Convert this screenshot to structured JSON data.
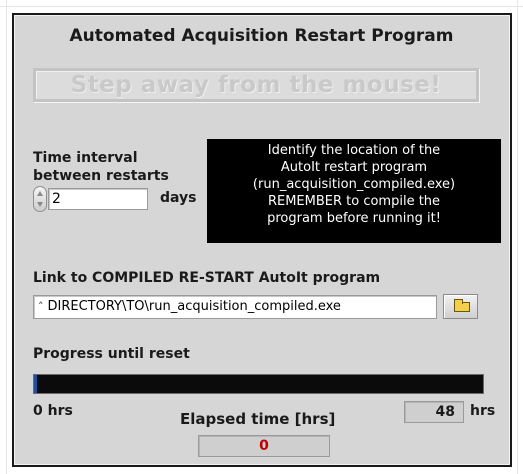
{
  "title": "Automated Acquisition Restart Program",
  "status_message": "Step away from the mouse!",
  "time_interval": {
    "label_line1": "Time interval",
    "label_line2": "between restarts",
    "value": "2",
    "unit": "days"
  },
  "info_box": {
    "line1": "Identify the location of the",
    "line2": "AutoIt restart program",
    "line3": "(run_acquisition_compiled.exe)",
    "line4": "REMEMBER to compile the",
    "line5": "program before running it!"
  },
  "program_link": {
    "label": "Link to COMPILED RE-START AutoIt program",
    "path": "DIRECTORY\\TO\\run_acquisition_compiled.exe",
    "path_icon": "path-glyph-icon",
    "browse_icon": "folder-icon"
  },
  "progress": {
    "label": "Progress until reset",
    "fraction": 0.006,
    "min_label": "0 hrs",
    "max_value": "48",
    "max_unit": "hrs",
    "elapsed_label": "Elapsed time [hrs]",
    "elapsed_value": "0"
  },
  "colors": {
    "panel_bg": "#d6d6d6",
    "info_bg": "#000000",
    "progress_track": "#0b0b0b",
    "progress_fill": "#1f4fa3",
    "elapsed_value": "#c00000"
  }
}
